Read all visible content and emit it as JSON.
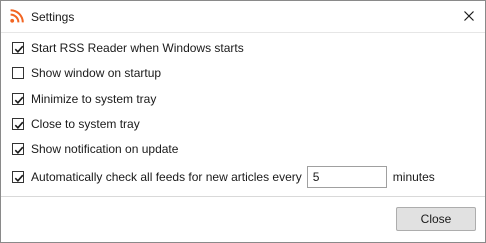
{
  "window": {
    "title": "Settings",
    "app_icon": "rss-icon",
    "close_icon": "close-icon"
  },
  "colors": {
    "rss_orange": "#f26522",
    "button_face": "#e1e1e1",
    "button_border": "#adadad"
  },
  "options": [
    {
      "label": "Start RSS Reader when Windows starts",
      "checked": true
    },
    {
      "label": "Show window on startup",
      "checked": false
    },
    {
      "label": "Minimize to system tray",
      "checked": true
    },
    {
      "label": "Close to system tray",
      "checked": true
    },
    {
      "label": "Show notification on update",
      "checked": true
    },
    {
      "label": "Automatically check all feeds for new articles every",
      "checked": true
    }
  ],
  "auto_check": {
    "interval_value": "5",
    "unit_label": "minutes"
  },
  "footer": {
    "close_label": "Close"
  }
}
